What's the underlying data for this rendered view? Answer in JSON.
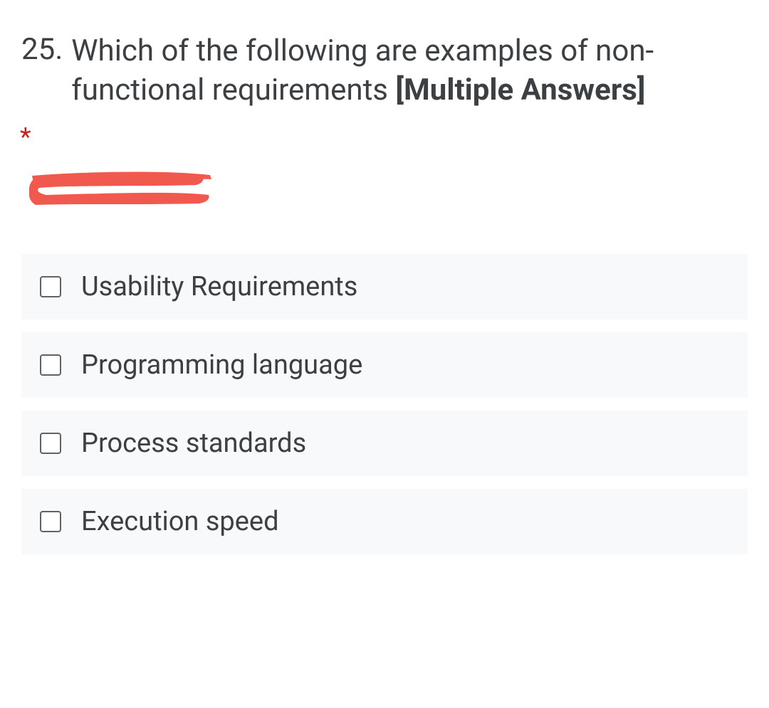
{
  "question": {
    "number": "25.",
    "text_part1": "Which of the following are examples of non-functional requirements ",
    "text_bold": "[Multiple Answers]",
    "required_marker": "*"
  },
  "options": [
    {
      "label": "Usability Requirements"
    },
    {
      "label": "Programming language"
    },
    {
      "label": "Process standards"
    },
    {
      "label": "Execution speed"
    }
  ],
  "annotation": {
    "redaction_color": "#f1584e"
  }
}
